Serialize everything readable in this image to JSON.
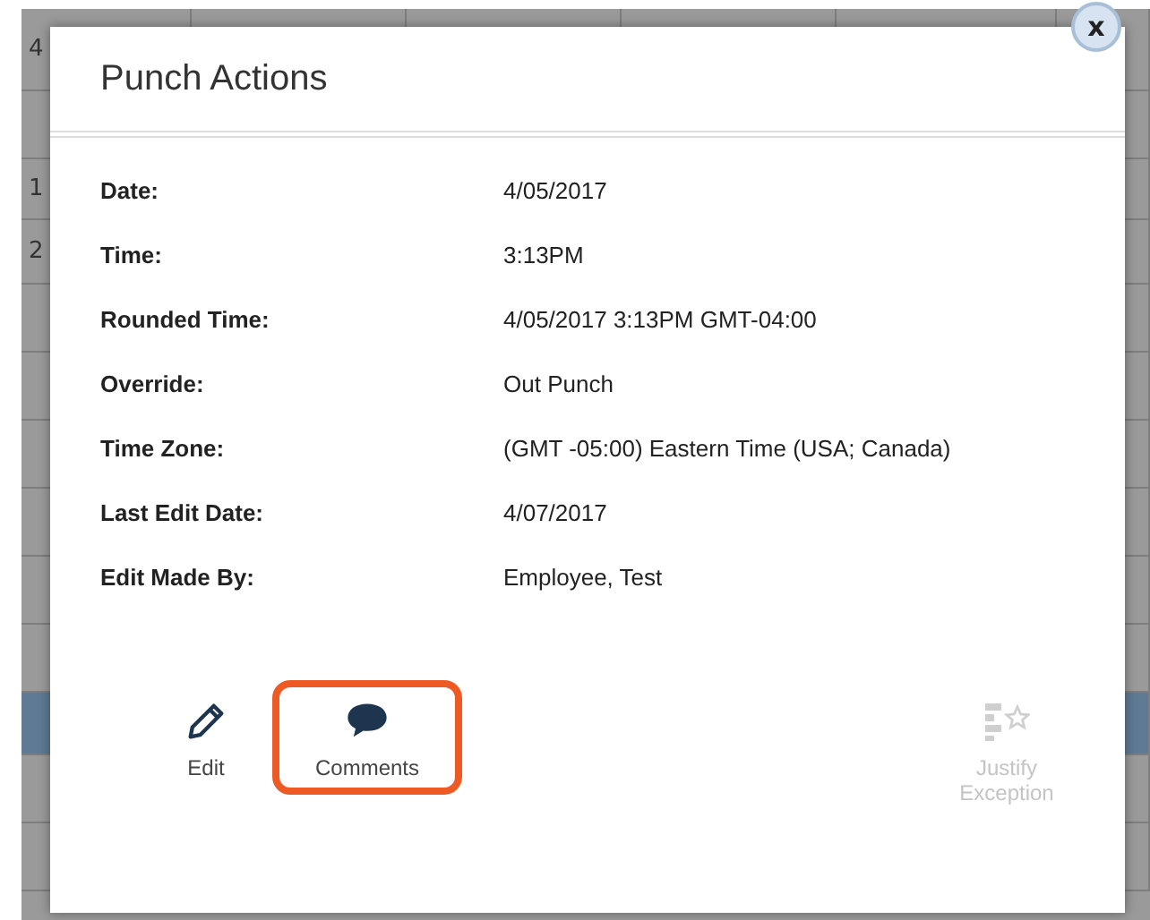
{
  "background_table": {
    "rows": [
      {
        "column_1": "4",
        "selected": false
      },
      {
        "selected": false
      },
      {
        "column_1": "1",
        "selected": false
      },
      {
        "column_1": "2",
        "selected": false
      },
      {
        "selected": false
      },
      {
        "selected": false
      },
      {
        "selected": false
      },
      {
        "selected": false
      },
      {
        "selected": false
      },
      {
        "selected": false
      },
      {
        "selected": true
      },
      {
        "selected": false
      },
      {
        "selected": false
      }
    ]
  },
  "dialog": {
    "title": "Punch Actions",
    "close": "x",
    "fields": [
      {
        "label": "Date:",
        "value": "4/05/2017"
      },
      {
        "label": "Time:",
        "value": "3:13PM"
      },
      {
        "label": "Rounded Time:",
        "value": "4/05/2017 3:13PM GMT-04:00"
      },
      {
        "label": "Override:",
        "value": "Out Punch"
      },
      {
        "label": "Time Zone:",
        "value": "(GMT -05:00) Eastern Time (USA; Canada)"
      },
      {
        "label": "Last Edit Date:",
        "value": "4/07/2017"
      },
      {
        "label": "Edit Made By:",
        "value": "Employee, Test"
      }
    ],
    "actions": [
      {
        "kind": "edit",
        "label": "Edit",
        "disabled": false,
        "highlighted": false
      },
      {
        "kind": "comments",
        "label": "Comments",
        "disabled": false,
        "highlighted": true
      },
      {
        "kind": "justify",
        "label": "Justify Exception",
        "disabled": true,
        "highlighted": false
      }
    ]
  }
}
